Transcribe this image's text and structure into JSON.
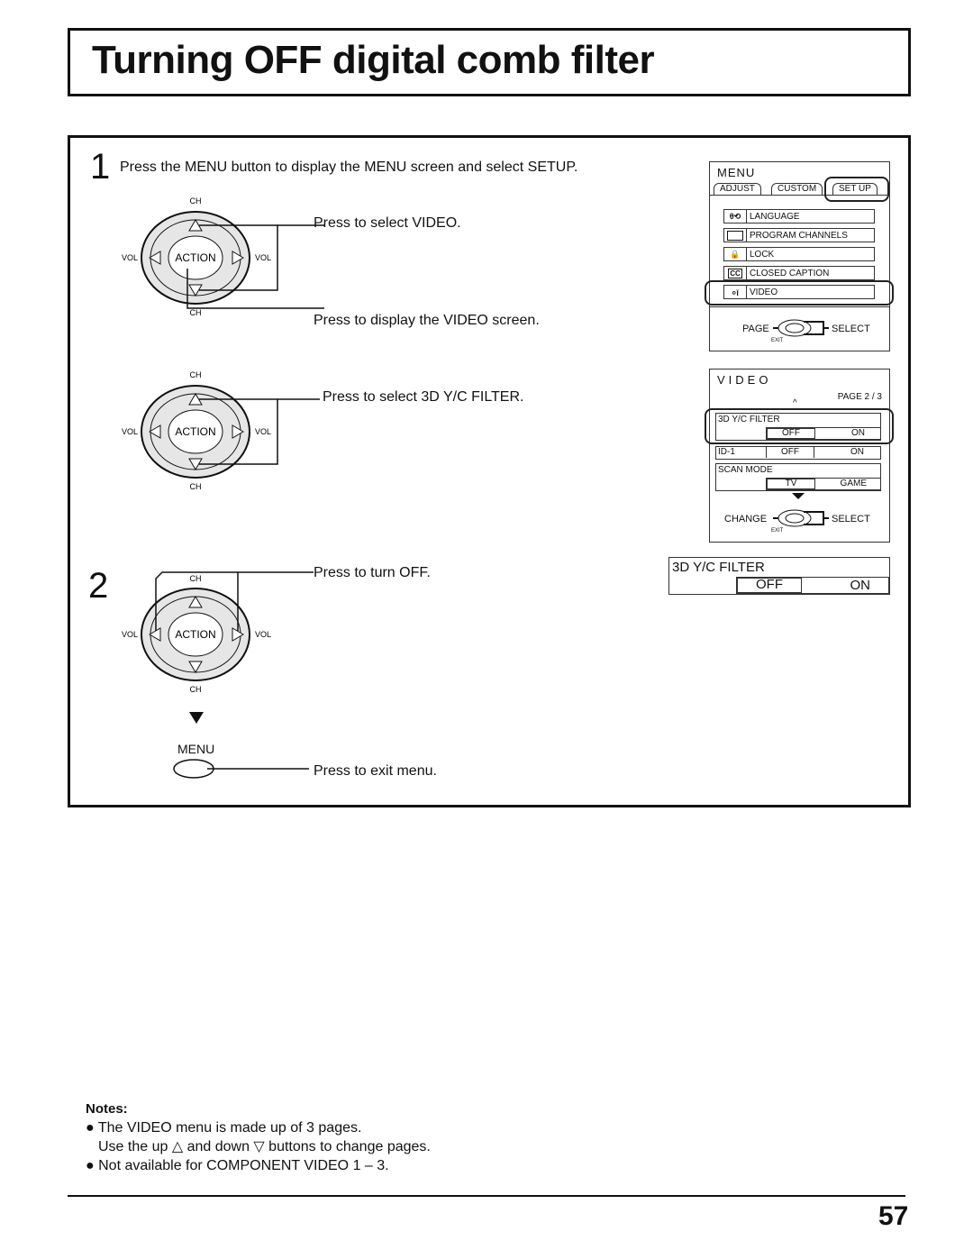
{
  "page": {
    "title": "Turning OFF digital comb filter",
    "page_number": "57"
  },
  "step1": {
    "number": "1",
    "instruction": "Press the MENU button to display the MENU screen and select SETUP.",
    "callouts": {
      "select_video": "Press to select VIDEO.",
      "display_video": "Press to display the VIDEO screen.",
      "select_filter": "Press to select 3D Y/C FILTER."
    }
  },
  "step2": {
    "number": "2",
    "callouts": {
      "turn_off": "Press to turn OFF.",
      "exit_menu": "Press to exit menu."
    },
    "menu_button_label": "MENU"
  },
  "remote": {
    "ch": "CH",
    "vol": "VOL",
    "action": "ACTION"
  },
  "menu_osd": {
    "title": "MENU",
    "tabs": [
      "ADJUST",
      "CUSTOM",
      "SET UP"
    ],
    "selected_tab": "SET UP",
    "items": [
      {
        "icon": "language-icon",
        "label": "LANGUAGE"
      },
      {
        "icon": "tv-icon",
        "label": "PROGRAM  CHANNELS"
      },
      {
        "icon": "lock-icon",
        "label": "LOCK"
      },
      {
        "icon": "cc-icon",
        "label": "CLOSED  CAPTION"
      },
      {
        "icon": "video-icon",
        "label": "VIDEO"
      }
    ],
    "selected_item": "VIDEO",
    "footer": {
      "left": "PAGE",
      "center": "ACTION",
      "right": "SELECT",
      "exit": "EXIT"
    }
  },
  "video_osd": {
    "title": "VIDEO",
    "page": "PAGE 2 / 3",
    "rows": [
      {
        "label": "3D Y/C FILTER",
        "options": [
          "OFF",
          "ON"
        ],
        "selected": "OFF"
      },
      {
        "label": "ID-1",
        "options": [
          "OFF",
          "ON"
        ],
        "selected": "OFF"
      },
      {
        "label": "SCAN  MODE",
        "options": [
          "TV",
          "GAME"
        ],
        "selected": "TV"
      }
    ],
    "footer": {
      "left": "CHANGE",
      "right": "SELECT",
      "exit": "EXIT"
    }
  },
  "filter_osd": {
    "label": "3D Y/C FILTER",
    "options": [
      "OFF",
      "ON"
    ],
    "selected": "OFF"
  },
  "notes": {
    "heading": "Notes:",
    "items": [
      "The VIDEO menu is made up of 3 pages.",
      "Use the up △ and down ▽ buttons to change pages.",
      "Not available for COMPONENT VIDEO 1 – 3."
    ]
  }
}
